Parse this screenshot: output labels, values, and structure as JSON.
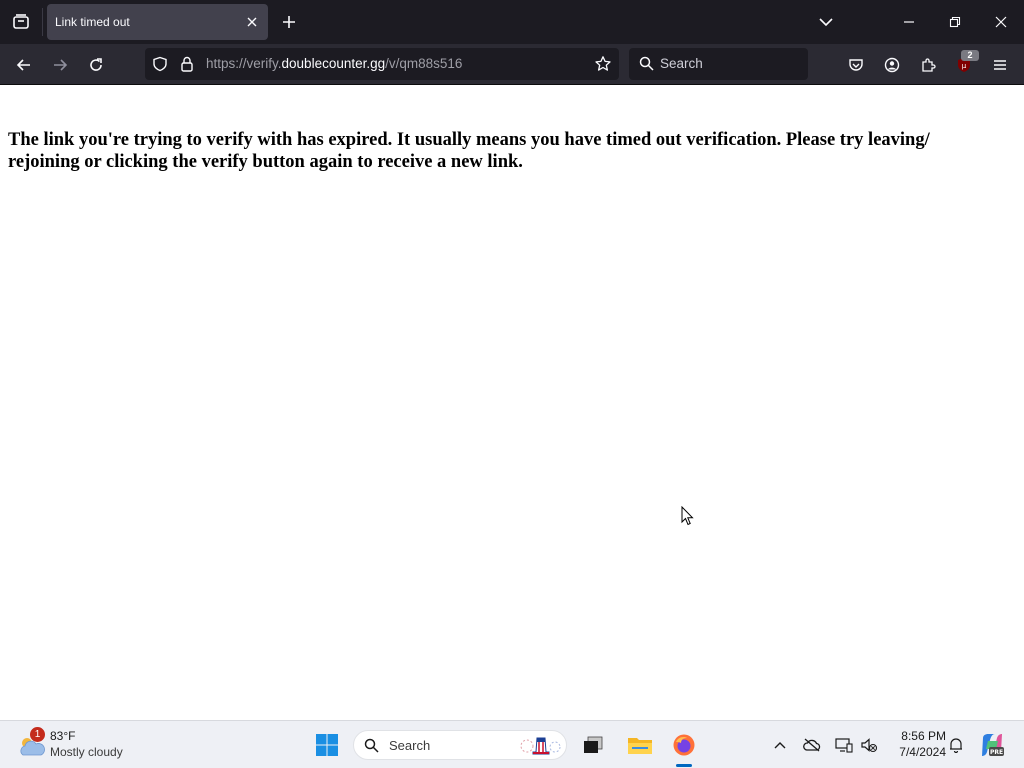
{
  "browser": {
    "tab": {
      "title": "Link timed out"
    },
    "url": {
      "prefix": "https://verify.",
      "domain": "doublecounter.gg",
      "path": "/v/qm88s516"
    },
    "search_placeholder": "Search",
    "extensions_badge": "2"
  },
  "page": {
    "message": "The link you're trying to verify with has expired. It usually means you have timed out verification. Please try leaving/ rejoining or clicking the verify button again to receive a new link."
  },
  "taskbar": {
    "weather": {
      "temp": "83°F",
      "condition": "Mostly cloudy",
      "badge": "1"
    },
    "search_label": "Search",
    "clock": {
      "time": "8:56 PM",
      "date": "7/4/2024"
    }
  },
  "colors": {
    "tabstrip": "#1c1b22",
    "navbar": "#2b2a33",
    "active_tab": "#42414d",
    "taskbar": "#eef0f5",
    "accent": "#0067c0"
  }
}
